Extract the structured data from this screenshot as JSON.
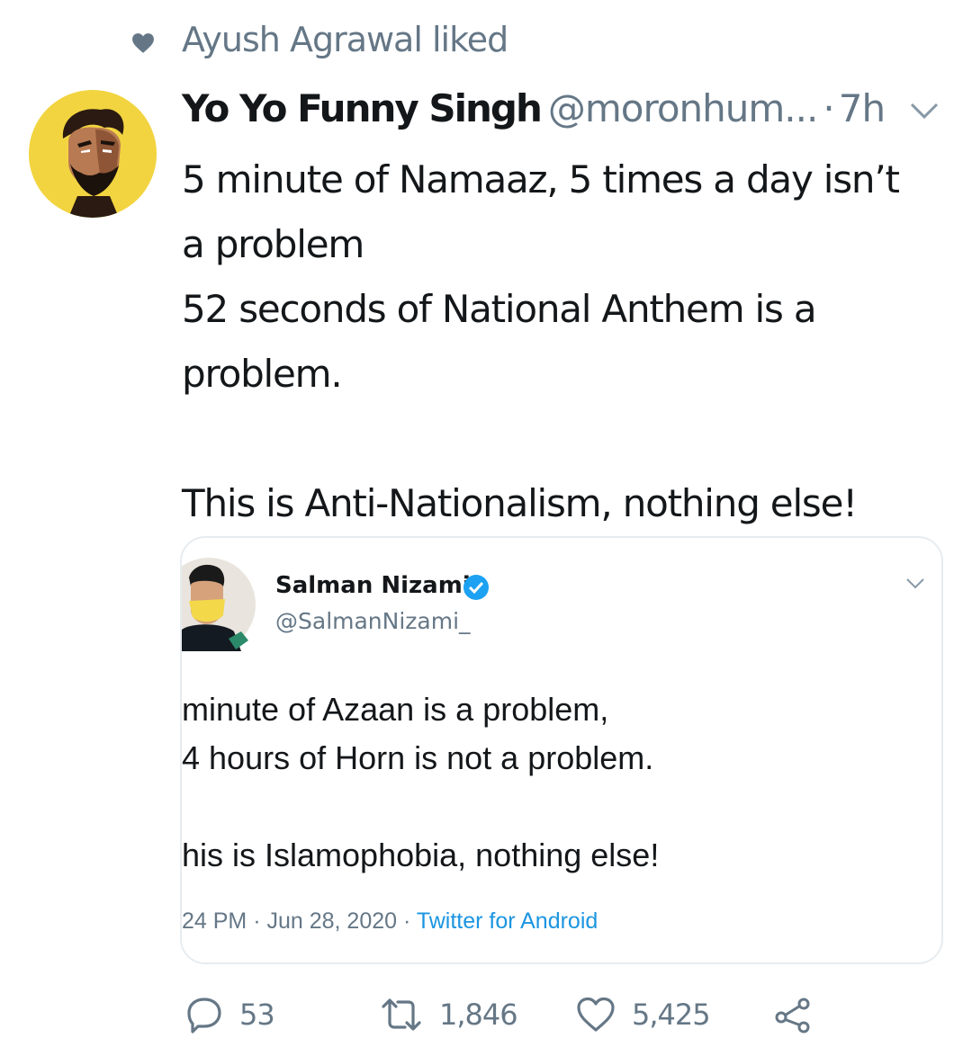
{
  "social_context": {
    "text": "Ayush Agrawal liked",
    "icon": "heart-icon"
  },
  "tweet": {
    "display_name": "Yo Yo Funny Singh",
    "handle": "@moronhum...",
    "separator": "·",
    "time": "7h",
    "lines": [
      "5 minute of Namaaz, 5 times a day isn’t",
      "a problem",
      "52 seconds of National Anthem is a",
      "problem.",
      "",
      "This is Anti-Nationalism, nothing else!"
    ]
  },
  "quoted": {
    "name": "Salman Nizami",
    "verified": true,
    "handle": "@SalmanNizami_",
    "lines": [
      "minute of Azaan is a problem,",
      "4 hours of Horn is not a problem.",
      "",
      "his is Islamophobia, nothing else!"
    ],
    "time": "24 PM · Jun 28, 2020 · ",
    "source": "Twitter for Android"
  },
  "actions": {
    "replies": "53",
    "retweets": "1,846",
    "likes": "5,425"
  },
  "colors": {
    "text": "#14171a",
    "muted": "#657786",
    "link": "#1b95e0",
    "avatar_bg": "#f2d440",
    "border": "#e6ecf0"
  }
}
